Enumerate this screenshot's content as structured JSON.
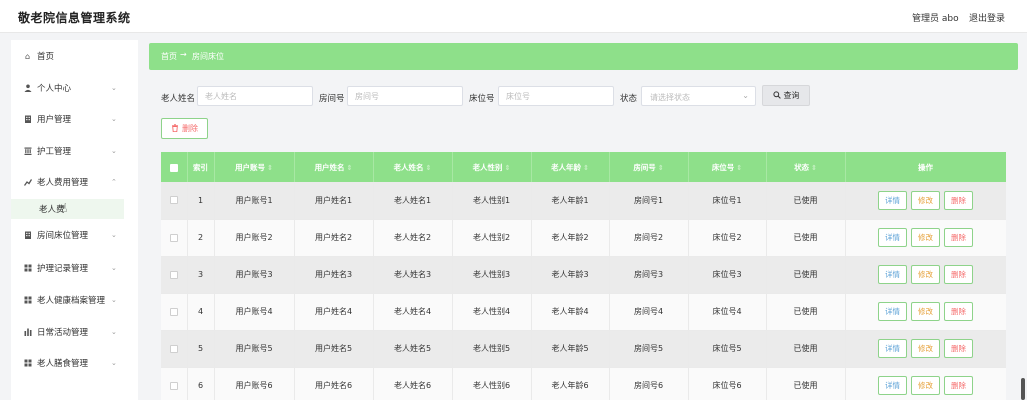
{
  "header": {
    "title": "敬老院信息管理系统",
    "admin": "管理员 abo",
    "logout": "退出登录"
  },
  "sidebar": {
    "items": [
      {
        "label": "首页",
        "icon": "home-icon",
        "has_chevron": false
      },
      {
        "label": "个人中心",
        "icon": "person-icon",
        "has_chevron": true
      },
      {
        "label": "用户管理",
        "icon": "building-icon",
        "has_chevron": true
      },
      {
        "label": "护工管理",
        "icon": "columns-icon",
        "has_chevron": true
      },
      {
        "label": "老人费用管理",
        "icon": "chart-icon",
        "has_chevron": true
      },
      {
        "label": "房间床位管理",
        "icon": "building-icon",
        "has_chevron": true
      },
      {
        "label": "护理记录管理",
        "icon": "grid-icon",
        "has_chevron": true
      },
      {
        "label": "老人健康档案管理",
        "icon": "grid-icon",
        "has_chevron": true
      },
      {
        "label": "日常活动管理",
        "icon": "bars-icon",
        "has_chevron": true
      },
      {
        "label": "老人膳食管理",
        "icon": "grid-icon",
        "has_chevron": true
      }
    ],
    "active_sub": "老人费"
  },
  "breadcrumb": {
    "home": "首页",
    "separator": "→",
    "current": "房间床位"
  },
  "search": {
    "elder_name_label": "老人姓名",
    "elder_name_placeholder": "老人姓名",
    "room_label": "房间号",
    "room_placeholder": "房间号",
    "bed_label": "床位号",
    "bed_placeholder": "床位号",
    "status_label": "状态",
    "status_placeholder": "请选择状态",
    "query_label": "查询"
  },
  "toolbar": {
    "delete_label": "删除"
  },
  "table": {
    "headers": [
      "索引",
      "用户账号",
      "用户姓名",
      "老人姓名",
      "老人性别",
      "老人年龄",
      "房间号",
      "床位号",
      "状态",
      "操作"
    ],
    "actions": {
      "detail": "详情",
      "edit": "修改",
      "delete": "删除"
    },
    "rows": [
      [
        "1",
        "用户账号1",
        "用户姓名1",
        "老人姓名1",
        "老人性别1",
        "老人年龄1",
        "房间号1",
        "床位号1",
        "已使用"
      ],
      [
        "2",
        "用户账号2",
        "用户姓名2",
        "老人姓名2",
        "老人性别2",
        "老人年龄2",
        "房间号2",
        "床位号2",
        "已使用"
      ],
      [
        "3",
        "用户账号3",
        "用户姓名3",
        "老人姓名3",
        "老人性别3",
        "老人年龄3",
        "房间号3",
        "床位号3",
        "已使用"
      ],
      [
        "4",
        "用户账号4",
        "用户姓名4",
        "老人姓名4",
        "老人性别4",
        "老人年龄4",
        "房间号4",
        "床位号4",
        "已使用"
      ],
      [
        "5",
        "用户账号5",
        "用户姓名5",
        "老人姓名5",
        "老人性别5",
        "老人年龄5",
        "房间号5",
        "床位号5",
        "已使用"
      ],
      [
        "6",
        "用户账号6",
        "用户姓名6",
        "老人姓名6",
        "老人性别6",
        "老人年龄6",
        "房间号6",
        "床位号6",
        "已使用"
      ]
    ]
  },
  "colors": {
    "accent": "#8ee08a",
    "danger": "#f56c6c",
    "warning": "#e6a23c",
    "info": "#5aa0d6"
  }
}
